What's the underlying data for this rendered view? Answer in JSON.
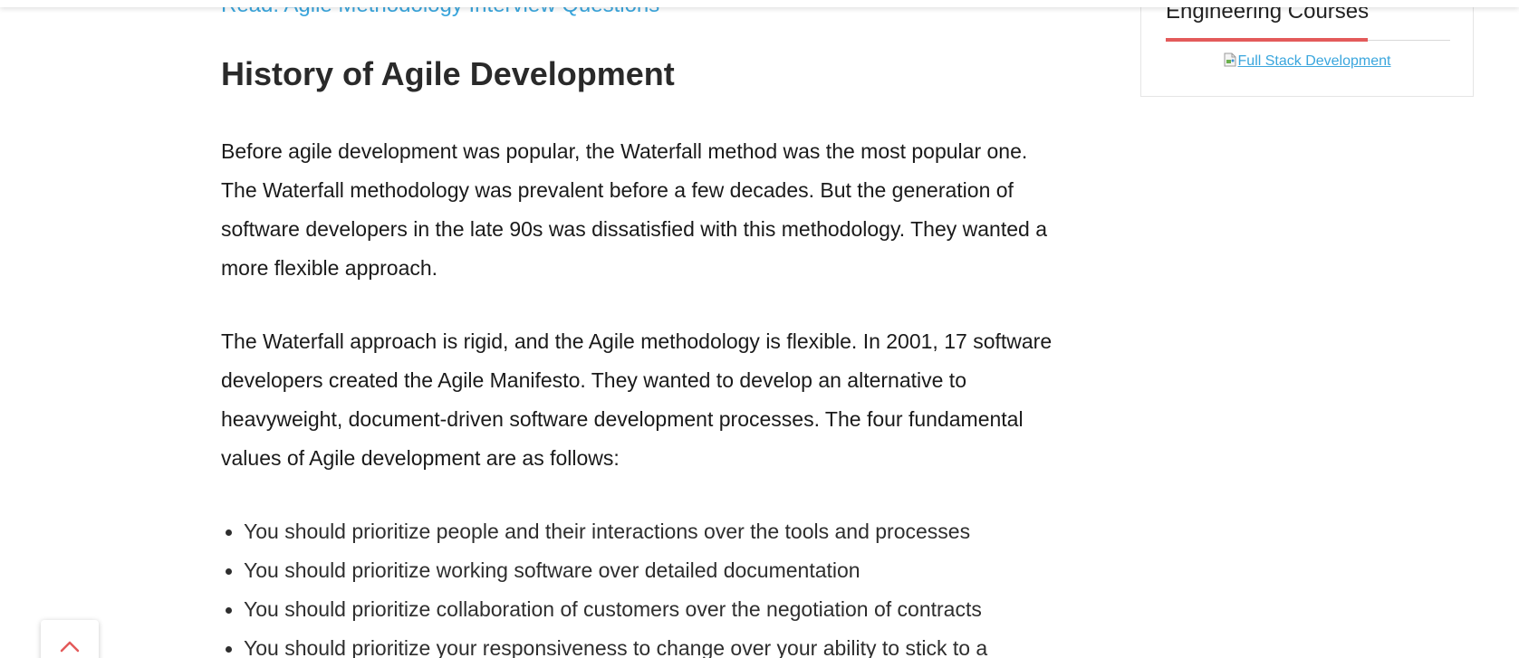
{
  "article": {
    "read_link": "Read: Agile Methodology Interview Questions",
    "heading": "History of Agile Development",
    "paragraphs": [
      "Before agile development was popular, the Waterfall method was the most popular one. The Waterfall methodology was prevalent before a few decades. But the generation of software developers in the late 90s was dissatisfied with this methodology. They wanted a more flexible approach.",
      "The Waterfall approach is rigid, and the Agile methodology is flexible. In 2001, 17 software developers created the Agile Manifesto. They wanted to develop an alternative to heavyweight, document-driven software development processes. The four fundamental values of Agile development are as follows:"
    ],
    "values": [
      "You should prioritize people and their interactions over the tools and processes",
      "You should prioritize working software over detailed documentation",
      "You should prioritize collaboration of customers over the negotiation of contracts",
      "You should prioritize your responsiveness to change over your ability to stick to a"
    ]
  },
  "sidebar": {
    "title": "Engineering Courses",
    "banner_alt": "Full Stack Development",
    "accent_color": "#e35a5a"
  },
  "scroll_top": {
    "icon": "chevron-up-icon",
    "color": "#e35a5a"
  },
  "colors": {
    "link": "#3aa6dd",
    "text": "#1a1a1a",
    "accent": "#e35a5a"
  }
}
